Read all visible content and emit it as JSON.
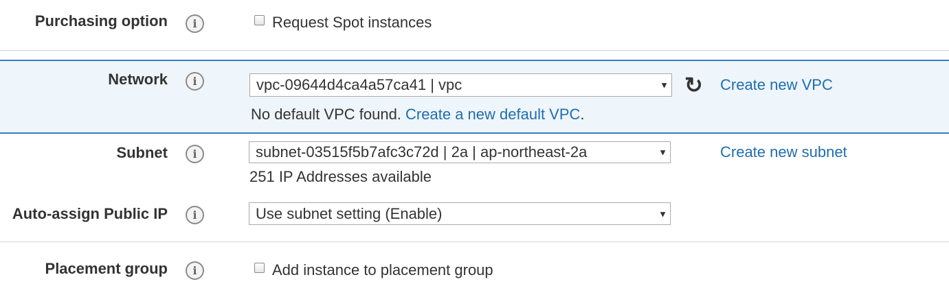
{
  "purchasing": {
    "label": "Purchasing option",
    "checkbox_label": "Request Spot instances"
  },
  "network": {
    "label": "Network",
    "selected": "vpc-09644d4ca4a57ca41 | vpc",
    "create_link": "Create new VPC",
    "help_text": "No default VPC found.",
    "help_link": "Create a new default VPC",
    "help_suffix": "."
  },
  "subnet": {
    "label": "Subnet",
    "selected": "subnet-03515f5b7afc3c72d | 2a | ap-northeast-2a",
    "create_link": "Create new subnet",
    "help_text": "251 IP Addresses available"
  },
  "public_ip": {
    "label": "Auto-assign Public IP",
    "selected": "Use subnet setting (Enable)"
  },
  "placement": {
    "label": "Placement group",
    "checkbox_label": "Add instance to placement group"
  },
  "icons": {
    "info": "info-icon",
    "refresh": "refresh-icon",
    "caret": "caret-down-icon"
  },
  "colors": {
    "link": "#1f6ead",
    "highlight_bg": "#eef5fb",
    "highlight_border": "#3a7cc0"
  }
}
